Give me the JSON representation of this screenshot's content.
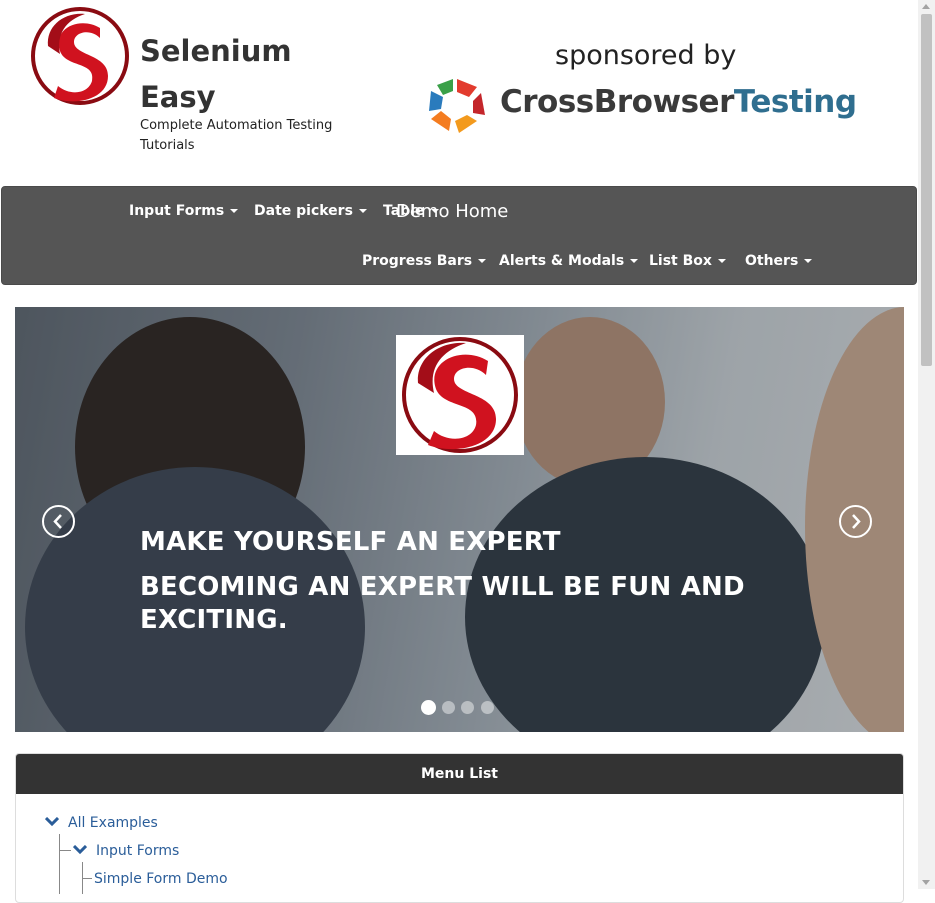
{
  "header": {
    "brand_title": "Selenium Easy",
    "brand_subtitle": "Complete Automation Testing Tutorials",
    "sponsor_label": "sponsored by",
    "sponsor_name_part1": "CrossBrowser",
    "sponsor_name_part2": "Testing"
  },
  "navbar": {
    "demo_home": "Demo Home",
    "row1": [
      "Input Forms",
      "Date pickers",
      "Table"
    ],
    "row2": [
      "Progress Bars",
      "Alerts & Modals",
      "List Box",
      "Others"
    ]
  },
  "carousel": {
    "headline": "MAKE YOURSELF AN EXPERT",
    "subheadline": "BECOMING AN EXPERT WILL BE FUN AND EXCITING.",
    "slide_count": 4,
    "active_slide": 1
  },
  "menu": {
    "heading": "Menu List",
    "items": [
      "All Examples",
      "Input Forms",
      "Simple Form Demo"
    ]
  },
  "colors": {
    "navbar_bg": "#555555",
    "menu_heading_bg": "#333333",
    "link": "#2a5d99",
    "logo_red": "#c8101e"
  }
}
